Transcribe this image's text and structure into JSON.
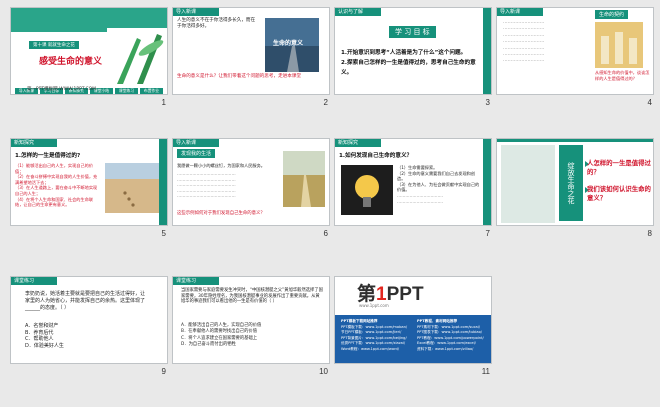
{
  "slides": [
    {
      "number": "1",
      "tag": "第十课  就就生命之花",
      "title": "感受生命的意义",
      "tabs": [
        "导入新课",
        "学习目标",
        "新知探究",
        "课堂小结",
        "课堂练习",
        "布置作业"
      ],
      "footer": "第一PPT模板网-WWW.1PPT.COM"
    },
    {
      "number": "2",
      "header": "导入新课",
      "text": "人生的意义不在于你活得多长久，而在于你活得多好。",
      "image_caption": "生命的意义",
      "question": "生命的意义是什么？让我们带着这个问题的思考，走进本课堂"
    },
    {
      "number": "3",
      "header": "认识与了解",
      "title": "学 习 目 标",
      "items": [
        "1.开始意识到思考“人活着是为了什么”这个问题。",
        "2.探索自己怎样的一生是值得过的，思考自己生命的意义。"
      ]
    },
    {
      "number": "4",
      "header": "导入新课",
      "badge": "生命的契约",
      "question": "从感知生命的价值中，谈谈怎样的人生是值得过的？"
    },
    {
      "number": "5",
      "header": "新知探究",
      "heading": "1.怎样的一生是值得过的?",
      "points": [
        "（1）能够活出自己的人生，实现自己的价值；",
        "（2）在奋斗拼搏中实现自我的人生价值，充满希望地活下去；",
        "（3）在人生道路上，要在奋斗中不断地实现自己的人生；",
        "（4）在将个人生命和国家、社会的生命联结，让自己的生命更有意义。"
      ]
    },
    {
      "number": "6",
      "header": "导入新课",
      "badge": "发现我的生活",
      "text": "我愿做一颗小小的螺丝钉，为国家和人民服务。",
      "question": "这些示例如何对于我们发现自己生命的意义？"
    },
    {
      "number": "7",
      "header": "新知探究",
      "heading": "1.如何发现自己生命的意义？",
      "points": [
        "（1）生命需要探索。",
        "（2）生命的意义需要我们自己去发现和创造。",
        "（3）在为他人、为社会做贡献中实现自己的价值。"
      ]
    },
    {
      "number": "8",
      "badge": "绽放生命之花",
      "questions": [
        "人怎样的一生是值得过的？",
        "我们该如何认识生命的意义？"
      ]
    },
    {
      "number": "9",
      "header": "课堂练习",
      "text": "李奶奶说，她活着主要就是要把自己的生活过得好，让家里的人为她省心，并能发挥自己的余热。这里体现了______的态度。（  ）",
      "options": [
        "A．名誉和财产",
        "B．养育后代",
        "C．帮助他人",
        "D．体验美好人生"
      ]
    },
    {
      "number": "10",
      "header": "课堂练习",
      "text": "当国家需要与家庭需要发生冲突时，“中国核潜艇之父”黄旭华毅然选择了国家需要，30年隐姓埋名，为我国核潜艇事业的发展作出了重要贡献。从黄旭华的事迹我们可以看出他的一生是有价值的（  ）",
      "options": [
        "A．能够活出自己的人生，实现自己的价值",
        "B．在奉献他人的需要时找出自己的价值",
        "C．将个人追求建立在国家需要的基础上",
        "D．为自己奋斗而付出的牺牲"
      ]
    },
    {
      "number": "11",
      "logo_main": "第",
      "logo_one": "1",
      "logo_tail": "PPT",
      "logo_sub": "www.1ppt.com",
      "left_title": "PPT模板下载网站推荐",
      "right_title": "PPT教程、素材网站推荐",
      "left_items": [
        "PPT模板下载：www.1ppt.com/moban/",
        "节日PPT模板：www.1ppt.com/jieri/",
        "PPT背景图片：www.1ppt.com/beijing/",
        "优秀PPT下载：www.1ppt.com/xiazai/",
        "Word教程：www.1ppt.com/word/"
      ],
      "right_items": [
        "PPT素材下载：www.1ppt.com/sucai/",
        "PPT图表下载：www.1ppt.com/tubiao/",
        "PPT教程：www.1ppt.com/powerpoint/",
        "Excel教程：www.1ppt.com/excel/",
        "资料下载：www.1ppt.com/ziliao/"
      ]
    }
  ]
}
